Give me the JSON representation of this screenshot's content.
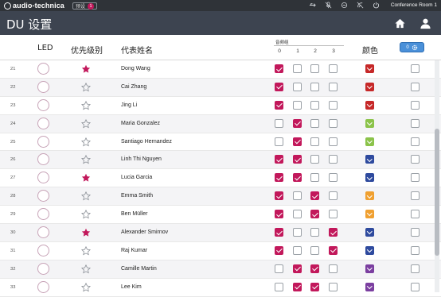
{
  "topbar": {
    "brand": "audio-technica",
    "preset_label": "预设",
    "preset_number": "1",
    "room_name": "Conference Room 1",
    "icons": [
      "usb-icon",
      "mic-off-icon",
      "link-icon",
      "signal-off-icon",
      "power-icon"
    ]
  },
  "titlebar": {
    "title": "DU 设置",
    "icons": [
      "home-icon",
      "user-icon"
    ]
  },
  "header": {
    "led": "LED",
    "priority": "优先级别",
    "name": "代表姓名",
    "freq_group": "音频组",
    "freq_numbers": [
      "0",
      "1",
      "2",
      "3"
    ],
    "color": "颜色",
    "color_button_label": "0"
  },
  "colors": {
    "accent": "#c2185b",
    "red": "#c62828",
    "green": "#8bc34a",
    "blue": "#2e4a9e",
    "orange": "#f0a030",
    "purple": "#7b3fa0",
    "button": "#4a90d9"
  },
  "rows": [
    {
      "num": "21",
      "name": "Dong Wang",
      "star": true,
      "groups": [
        true,
        false,
        false,
        false
      ],
      "color": "#c62828"
    },
    {
      "num": "22",
      "name": "Cai Zhang",
      "star": false,
      "groups": [
        true,
        false,
        false,
        false
      ],
      "color": "#c62828"
    },
    {
      "num": "23",
      "name": "Jing Li",
      "star": false,
      "groups": [
        true,
        false,
        false,
        false
      ],
      "color": "#c62828"
    },
    {
      "num": "24",
      "name": "Maria Gonzalez",
      "star": false,
      "groups": [
        false,
        true,
        false,
        false
      ],
      "color": "#8bc34a"
    },
    {
      "num": "25",
      "name": "Santiago Hernandez",
      "star": false,
      "groups": [
        false,
        true,
        false,
        false
      ],
      "color": "#8bc34a"
    },
    {
      "num": "26",
      "name": "Linh Thi Nguyen",
      "star": false,
      "groups": [
        true,
        true,
        false,
        false
      ],
      "color": "#2e4a9e"
    },
    {
      "num": "27",
      "name": "Lucia Garcia",
      "star": true,
      "groups": [
        true,
        true,
        false,
        false
      ],
      "color": "#2e4a9e"
    },
    {
      "num": "28",
      "name": "Emma Smith",
      "star": false,
      "groups": [
        true,
        false,
        true,
        false
      ],
      "color": "#f0a030"
    },
    {
      "num": "29",
      "name": "Ben Müller",
      "star": false,
      "groups": [
        true,
        false,
        true,
        false
      ],
      "color": "#f0a030"
    },
    {
      "num": "30",
      "name": "Alexander Smirnov",
      "star": true,
      "groups": [
        true,
        false,
        false,
        true
      ],
      "color": "#2e4a9e"
    },
    {
      "num": "31",
      "name": "Raj Kumar",
      "star": false,
      "groups": [
        true,
        false,
        false,
        true
      ],
      "color": "#2e4a9e"
    },
    {
      "num": "32",
      "name": "Camille Martin",
      "star": false,
      "groups": [
        false,
        true,
        true,
        false
      ],
      "color": "#7b3fa0"
    },
    {
      "num": "33",
      "name": "Lee Kim",
      "star": false,
      "groups": [
        false,
        true,
        true,
        false
      ],
      "color": "#7b3fa0"
    }
  ]
}
